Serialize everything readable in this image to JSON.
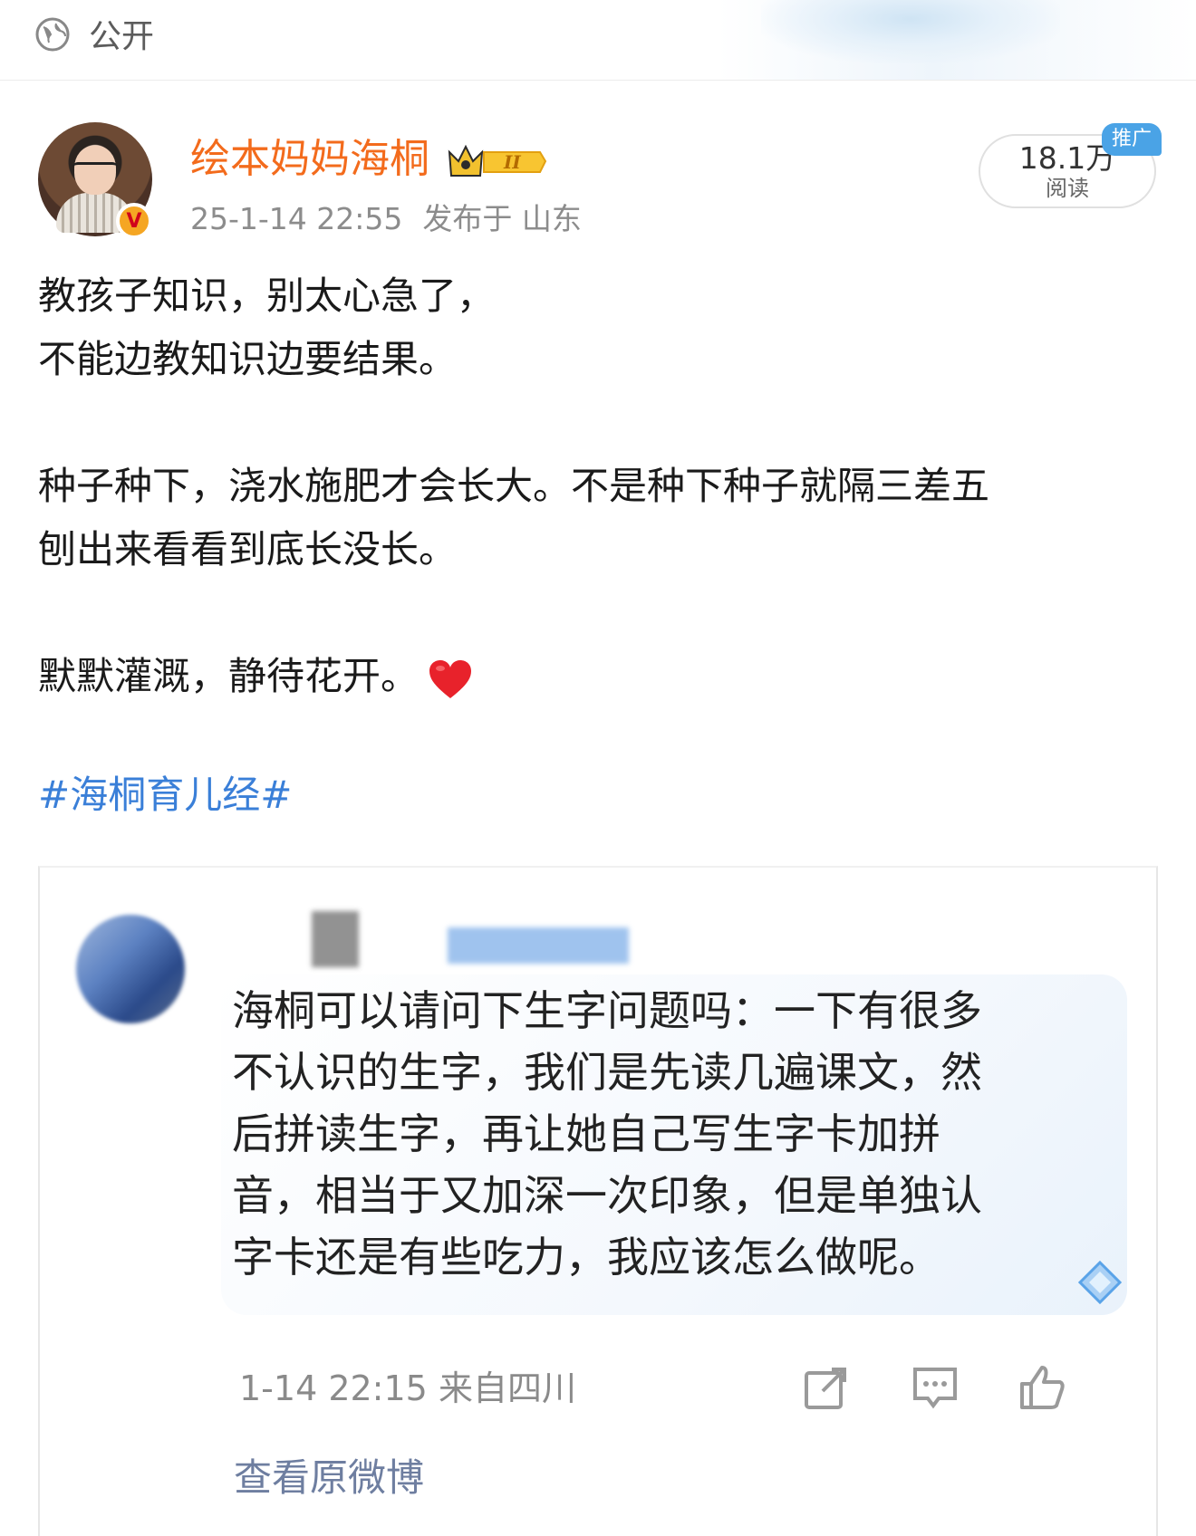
{
  "topbar": {
    "visibility_label": "公开",
    "globe_icon": "globe-icon"
  },
  "author": {
    "name": "绘本妈妈海桐",
    "verified_badge": "V",
    "level_icon": "crown-level-icon",
    "timestamp": "25-1-14 22:55",
    "location": "发布于 山东"
  },
  "stats": {
    "reads_value": "18.1万",
    "reads_label": "阅读",
    "promo_label": "推广"
  },
  "post": {
    "lines": [
      "教孩子知识，别太心急了，",
      "不能边教知识边要结果。",
      "",
      "种子种下，浇水施肥才会长大。不是种下种子就隔三差五",
      "刨出来看看到底长没长。",
      "",
      "默默灌溉，静待花开。"
    ],
    "emoji": "heart-icon",
    "hashtag": "#海桐育儿经#"
  },
  "embedded_screenshot": {
    "comment_lines": [
      "海桐可以请问下生字问题吗：一下有很多",
      "不认识的生字，我们是先读几遍课文，然",
      "后拼读生字，再让她自己写生字卡加拼",
      "音，相当于又加深一次印象，但是单独认",
      "字卡还是有些吃力，我应该怎么做呢。"
    ],
    "comment_time": "1-14 22:15",
    "comment_location": "来自四川",
    "actions": [
      "share-icon",
      "comment-icon",
      "like-icon"
    ],
    "view_original": "查看原微博"
  },
  "colors": {
    "username": "#f36b1c",
    "hashtag": "#3a7fd8",
    "promo": "#4aa3e6",
    "heart": "#e8222b"
  }
}
